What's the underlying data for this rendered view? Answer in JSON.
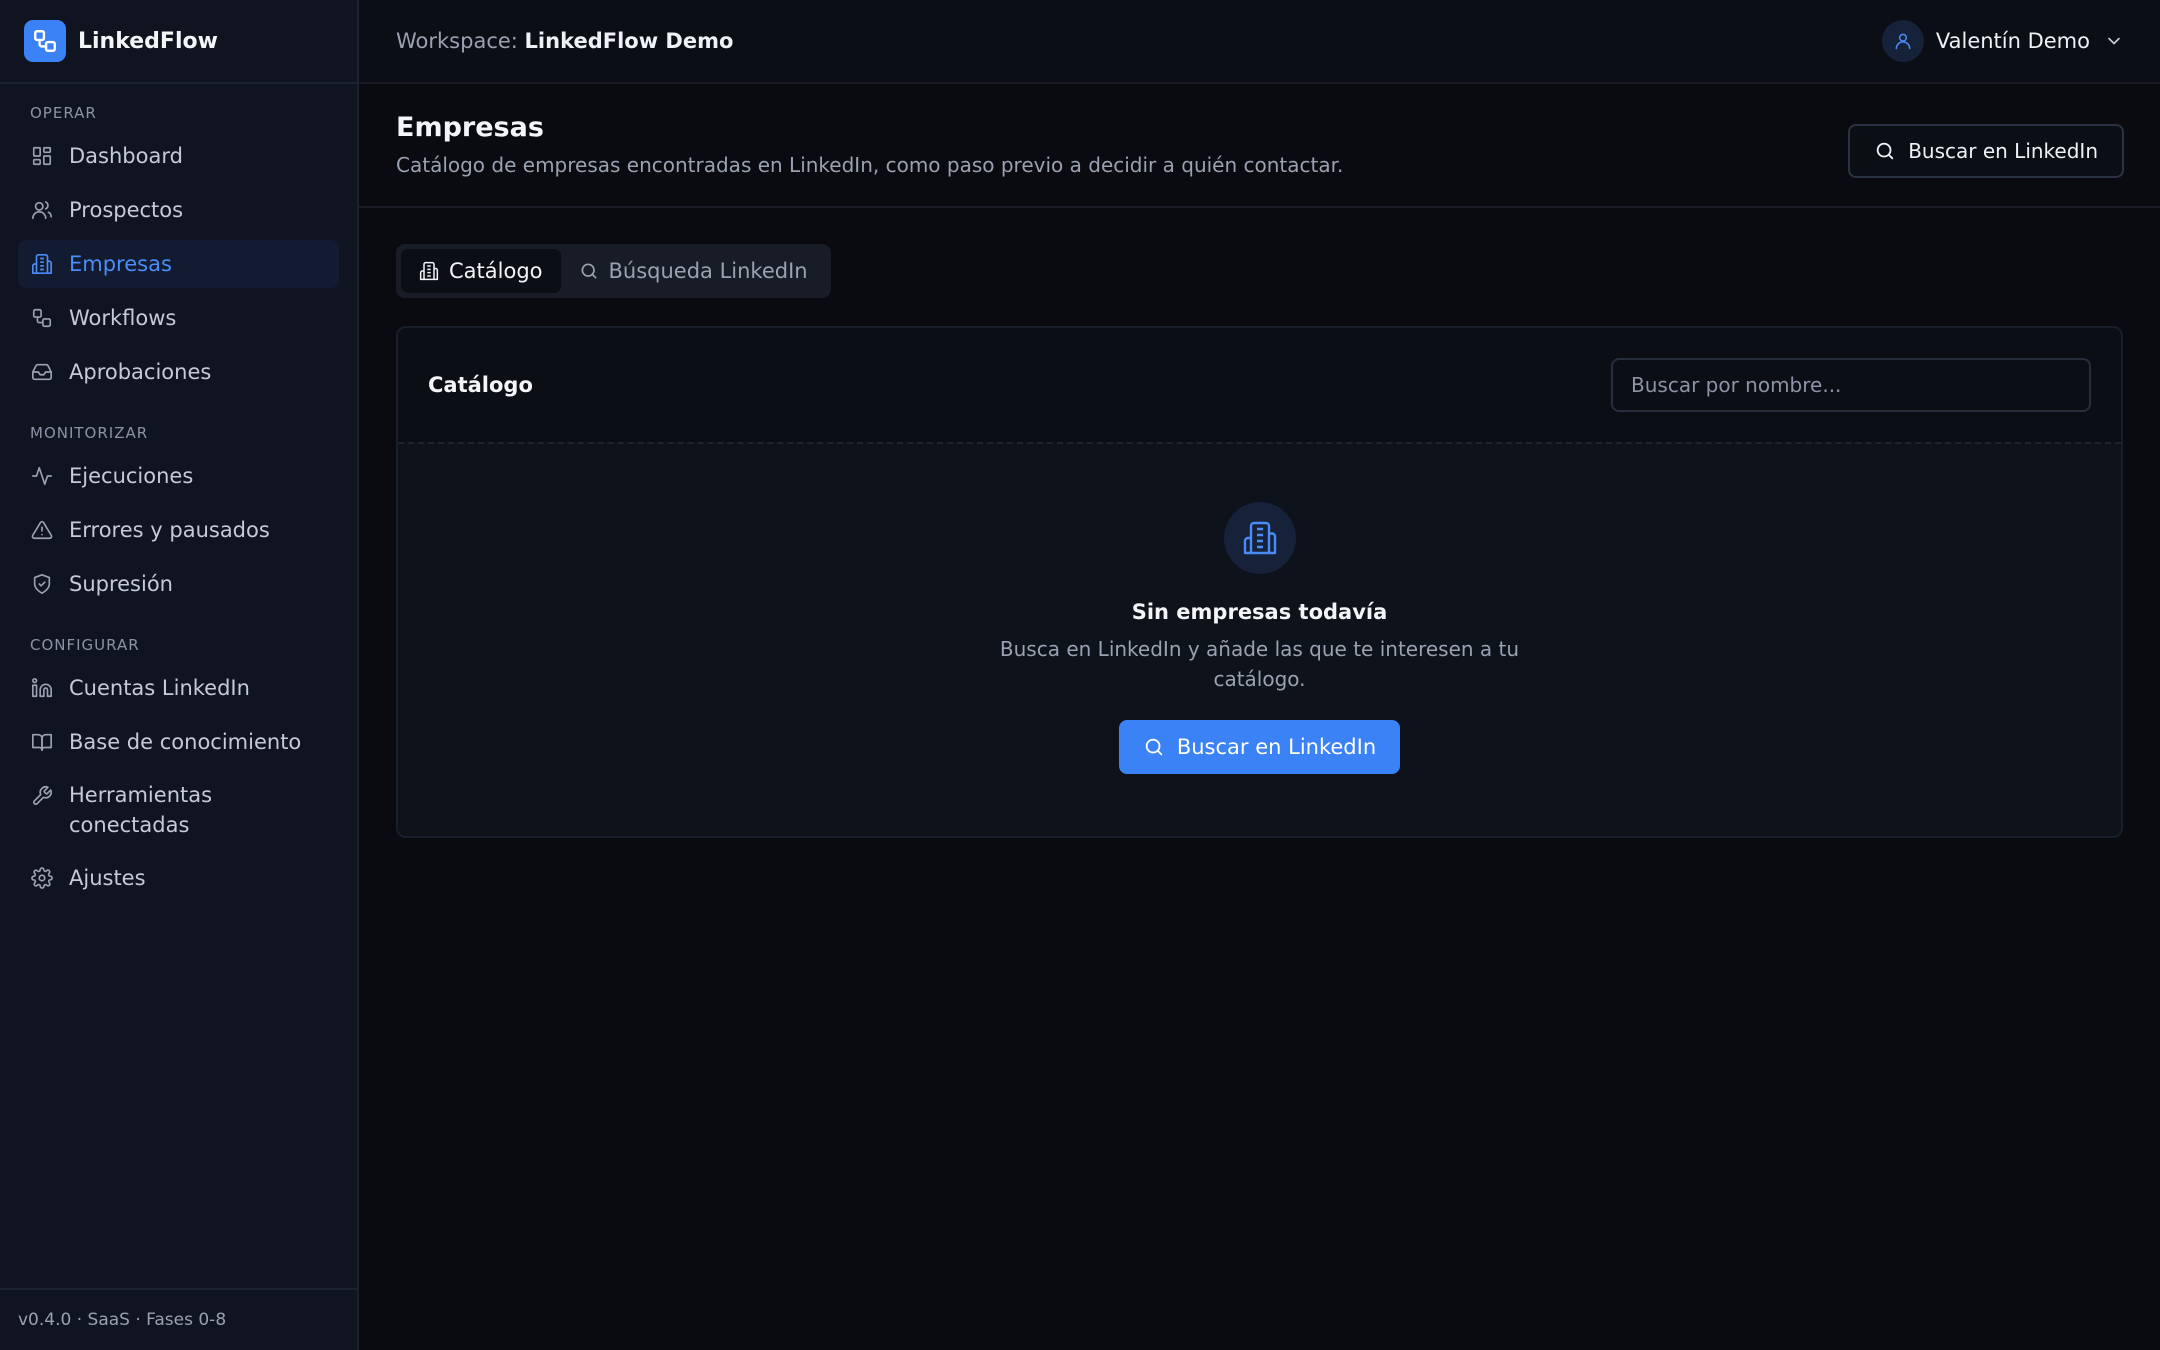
{
  "brand": {
    "name": "LinkedFlow"
  },
  "sidebar": {
    "sections": [
      {
        "label": "OPERAR",
        "items": [
          {
            "label": "Dashboard",
            "icon": "dashboard-icon"
          },
          {
            "label": "Prospectos",
            "icon": "users-icon"
          },
          {
            "label": "Empresas",
            "icon": "building-icon",
            "active": true
          },
          {
            "label": "Workflows",
            "icon": "workflow-icon"
          },
          {
            "label": "Aprobaciones",
            "icon": "inbox-icon"
          }
        ]
      },
      {
        "label": "MONITORIZAR",
        "items": [
          {
            "label": "Ejecuciones",
            "icon": "activity-icon"
          },
          {
            "label": "Errores y pausados",
            "icon": "warning-icon"
          },
          {
            "label": "Supresión",
            "icon": "shield-icon"
          }
        ]
      },
      {
        "label": "CONFIGURAR",
        "items": [
          {
            "label": "Cuentas LinkedIn",
            "icon": "linkedin-icon"
          },
          {
            "label": "Base de conocimiento",
            "icon": "book-icon"
          },
          {
            "label": "Herramientas conectadas",
            "icon": "wrench-icon"
          },
          {
            "label": "Ajustes",
            "icon": "gear-icon"
          }
        ]
      }
    ],
    "footer": "v0.4.0 · SaaS · Fases 0-8"
  },
  "topbar": {
    "workspace_label": "Workspace:",
    "workspace_name": "LinkedFlow Demo",
    "user_name": "Valentín Demo"
  },
  "page": {
    "title": "Empresas",
    "subtitle": "Catálogo de empresas encontradas en LinkedIn, como paso previo a decidir a quién contactar.",
    "header_button": "Buscar en LinkedIn"
  },
  "tabs": [
    {
      "label": "Catálogo",
      "icon": "building-icon",
      "active": true
    },
    {
      "label": "Búsqueda LinkedIn",
      "icon": "search-icon",
      "active": false
    }
  ],
  "card": {
    "title": "Catálogo",
    "search_placeholder": "Buscar por nombre..."
  },
  "empty_state": {
    "title": "Sin empresas todavía",
    "text": "Busca en LinkedIn y añade las que te interesen a tu catálogo.",
    "button": "Buscar en LinkedIn"
  },
  "colors": {
    "accent": "#3b82f6",
    "background": "#090b10",
    "sidebar": "#0f1420"
  }
}
